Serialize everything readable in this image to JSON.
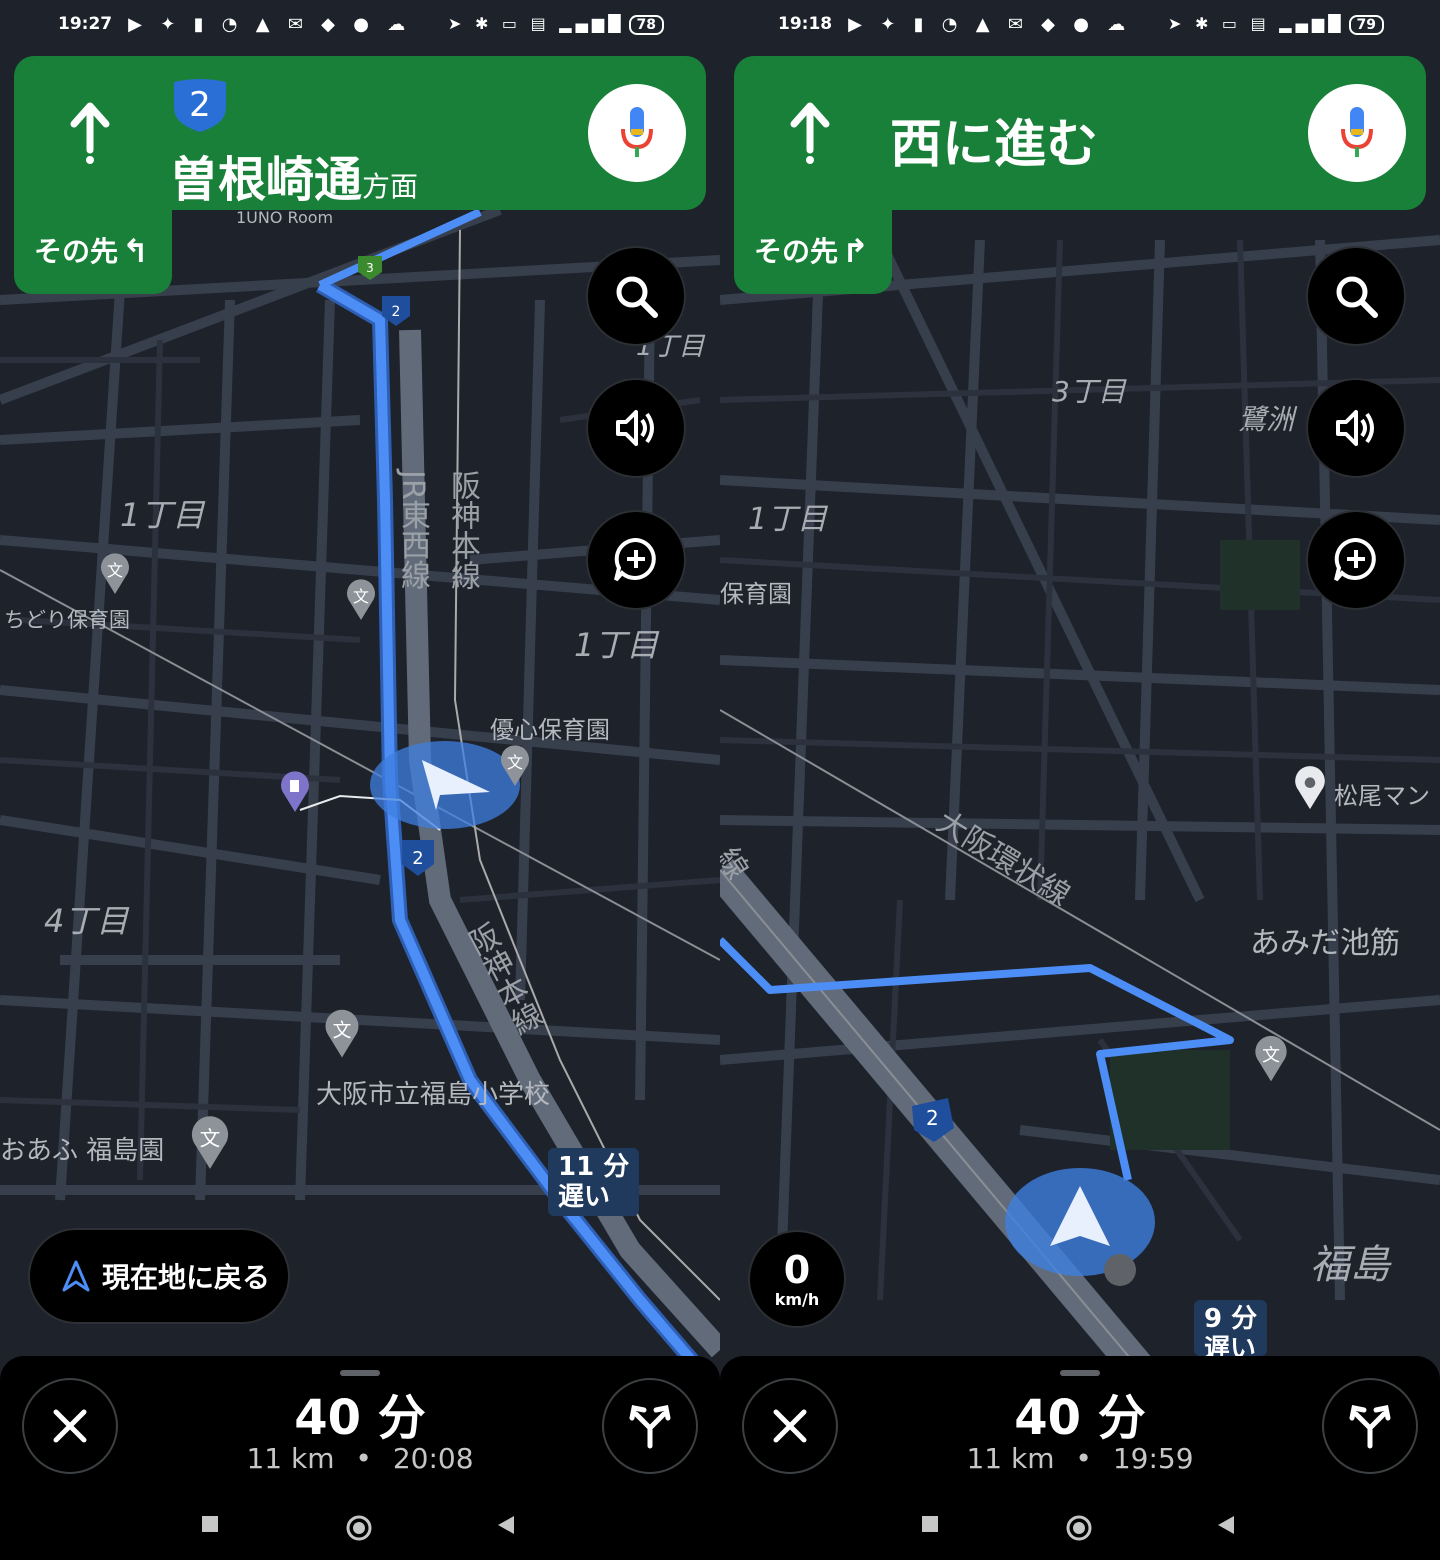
{
  "left": {
    "status": {
      "time": "19:27",
      "battery": "78"
    },
    "nav": {
      "route_number": "2",
      "street": "曽根崎通",
      "street_suffix": "方面",
      "then_label": "その先",
      "then_arrow": "↰"
    },
    "map_labels": {
      "l1": "1丁目",
      "l2": "1丁目",
      "l3": "1丁目",
      "l4": "4丁目",
      "building": "1UNO Room",
      "nursery1": "ちどり保育園",
      "nursery2": "優心保育園",
      "school": "大阪市立福島小学校",
      "kindergarten": "おあふ 福島園",
      "rail1": "JR東西線",
      "rail2": "阪神本線",
      "rail3": "阪神本線",
      "school_icon": "文"
    },
    "delay": {
      "line1": "11 分",
      "line2": "遅い"
    },
    "recenter_label": "現在地に戻る",
    "eta": {
      "duration": "40 分",
      "distance": "11 km",
      "arrival": "20:08",
      "separator": "•"
    }
  },
  "right": {
    "status": {
      "time": "19:18",
      "battery": "79"
    },
    "nav": {
      "direction": "西に進む",
      "then_label": "その先",
      "then_arrow": "↱"
    },
    "map_labels": {
      "l1": "3丁目",
      "l2": "1丁目",
      "sagisu": "鷺洲",
      "nursery": "保育園",
      "mansion": "松尾マン",
      "loop_line": "大阪環状線",
      "amida": "あみだ池筋",
      "fukushima": "福島",
      "line_frag": "線",
      "route_number": "2",
      "school_icon": "文"
    },
    "delay": {
      "line1": "9 分",
      "line2": "遅い"
    },
    "speed": {
      "value": "0",
      "unit": "km/h"
    },
    "eta": {
      "duration": "40 分",
      "distance": "11 km",
      "arrival": "19:59",
      "separator": "•"
    }
  },
  "colors": {
    "nav_green": "#188038",
    "route_blue": "#4c8df6",
    "map_bg": "#1d222b",
    "road": "#3a4150"
  },
  "icons": [
    "play-icon",
    "twitter-icon",
    "trash-icon",
    "gauge-icon",
    "navigation-icon",
    "gmail-icon",
    "location-icon",
    "mic-icon",
    "search-icon",
    "volume-icon",
    "add-report-icon",
    "close-icon",
    "alternate-routes-icon",
    "recenter-icon",
    "square-icon",
    "circle-icon",
    "back-icon"
  ]
}
